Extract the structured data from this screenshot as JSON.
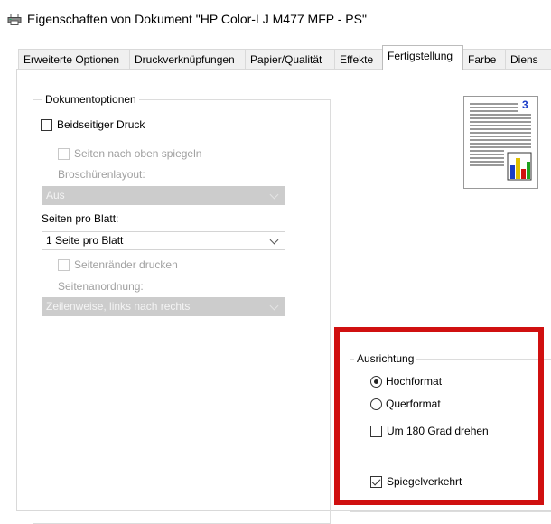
{
  "window": {
    "title": "Eigenschaften von Dokument \"HP Color-LJ M477 MFP - PS\"",
    "icon": "printer-icon"
  },
  "tabs": [
    {
      "label": "Erweiterte Optionen",
      "active": false
    },
    {
      "label": "Druckverknüpfungen",
      "active": false
    },
    {
      "label": "Papier/Qualität",
      "active": false
    },
    {
      "label": "Effekte",
      "active": false
    },
    {
      "label": "Fertigstellung",
      "active": true
    },
    {
      "label": "Farbe",
      "active": false
    },
    {
      "label": "Diens",
      "active": false
    }
  ],
  "document_options": {
    "legend": "Dokumentoptionen",
    "duplex": {
      "label": "Beidseitiger Druck",
      "checked": false
    },
    "mirror_pages_up": {
      "label": "Seiten nach oben spiegeln",
      "checked": false,
      "enabled": false
    },
    "booklet_label": "Broschürenlayout:",
    "booklet_value": "Aus",
    "pages_per_sheet_label": "Seiten pro Blatt:",
    "pages_per_sheet_value": "1 Seite pro Blatt",
    "print_borders": {
      "label": "Seitenränder drucken",
      "checked": false,
      "enabled": false
    },
    "page_order_label": "Seitenanordnung:",
    "page_order_value": "Zeilenweise, links nach rechts"
  },
  "orientation": {
    "legend": "Ausrichtung",
    "portrait": {
      "label": "Hochformat",
      "selected": true
    },
    "landscape": {
      "label": "Querformat",
      "selected": false
    },
    "rotate_180": {
      "label": "Um 180 Grad drehen",
      "checked": false
    },
    "mirror": {
      "label": "Spiegelverkehrt",
      "checked": true
    }
  },
  "preview": {
    "page_number": "3"
  },
  "colors": {
    "highlight": "#d01010",
    "disabled_fill": "#cccccc"
  }
}
